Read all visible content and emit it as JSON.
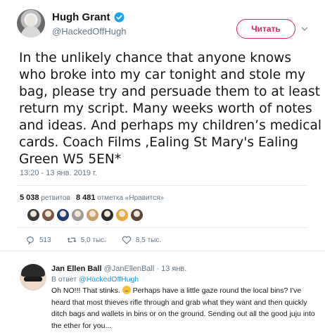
{
  "tweet": {
    "display_name": "Hugh Grant",
    "handle": "@HackedOffHugh",
    "follow_label": "Читать",
    "text": "In the unlikely chance that anyone knows who broke into my car tonight and stole my bag, please try and persuade them to at least return my script. Many weeks worth of notes and ideas. And perhaps my children’s medical cards. Coach Films ,Ealing St Mary's Ealing Green  W5 5EN*",
    "timestamp": "13:20 - 13 янв. 2019 г.",
    "stats": {
      "retweets_count": "5 038",
      "retweets_label": "ретвитов",
      "likes_count": "8 481",
      "likes_label": "отметка «Нравится»"
    },
    "likers": [
      "#3a3a3a",
      "#7b5a43",
      "#1f3b73",
      "#9b9b9b",
      "#c9a063",
      "#2b2b2b",
      "#e8a93c",
      "#5c4536"
    ],
    "actions": {
      "replies": "513",
      "retweets": "5,0 тыс.",
      "likes": "8,5 тыс."
    }
  },
  "reply": {
    "display_name": "Jan Ellen Ball",
    "handle": "@JanEllenBall",
    "time": "· 13 янв.",
    "reply_to_prefix": "В ответ",
    "reply_to_mention": "@HackedOffHugh",
    "text_before_emoji": "Oh NO!!! That stinks. ",
    "text_after_emoji": " Perhaps have a little gaze round the local bins? I've heard that most thieves rifle through and grab what they want and then quickly ditch bags and wallets in bins or on the ground. Sending out all the good juju into the ether for you..."
  },
  "colors": {
    "accent_red": "#e0245e",
    "link_blue": "#1b95e0",
    "muted": "#657786",
    "verified": "#1da1f2"
  }
}
